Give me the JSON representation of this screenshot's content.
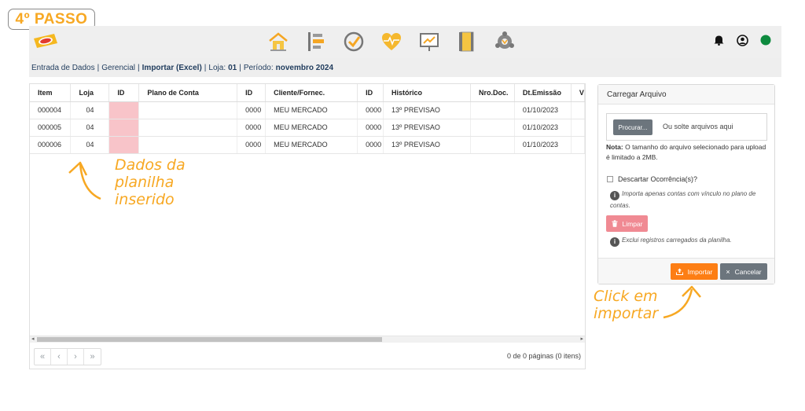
{
  "step_badge": "4º PASSO",
  "breadcrumb": {
    "part1": "Entrada de Dados",
    "part2": "Gerencial",
    "part3": "Importar (Excel)",
    "loja_label": "Loja:",
    "loja_value": "01",
    "periodo_label": "Período:",
    "periodo_value": "novembro 2024"
  },
  "nav": {
    "icons": [
      "home-icon",
      "hierarchy-list-icon",
      "check-circle-icon",
      "heart-pulse-icon",
      "chart-board-icon",
      "notebook-icon",
      "gear-network-icon"
    ]
  },
  "top_right": {
    "icons": [
      "bell-icon",
      "user-icon",
      "status-dot-icon"
    ],
    "status_color": "#0d8a3e"
  },
  "grid": {
    "columns": [
      "Item",
      "Loja",
      "ID",
      "Plano de Conta",
      "ID",
      "Cliente/Fornec.",
      "ID",
      "Histórico",
      "Nro.Doc.",
      "Dt.Emissão",
      "V"
    ],
    "rows": [
      [
        "000004",
        "04",
        "",
        "",
        "0000",
        "MEU MERCADO",
        "0000",
        "13º PREVISAO",
        "",
        "01/10/2023",
        ""
      ],
      [
        "000005",
        "04",
        "",
        "",
        "0000",
        "MEU MERCADO",
        "0000",
        "13º PREVISAO",
        "",
        "01/10/2023",
        ""
      ],
      [
        "000006",
        "04",
        "",
        "",
        "0000",
        "MEU MERCADO",
        "0000",
        "13º PREVISAO",
        "",
        "01/10/2023",
        ""
      ]
    ],
    "pager": [
      "«",
      "‹",
      "›",
      "»"
    ],
    "pager_info": "0 de 0 páginas (0 itens)"
  },
  "upload": {
    "title": "Carregar Arquivo",
    "browse_label": "Procurar...",
    "drop_text": "Ou solte arquivos aqui",
    "note_bold": "Nota:",
    "note_text": " O tamanho do arquivo selecionado para upload é limitado a 2MB.",
    "checkbox_label": "Descartar Ocorrência(s)?",
    "info1": "Importa apenas contas com vínculo no plano de contas.",
    "clear_label": "Limpar",
    "info2": "Exclui registros carregados da planilha.",
    "import_label": "Importar",
    "cancel_label": "Cancelar"
  },
  "annotations": {
    "data_note": [
      "Dados da",
      "planilha",
      "inserido"
    ],
    "click_note": [
      "Click em",
      "importar"
    ],
    "color": "#f7a823"
  }
}
